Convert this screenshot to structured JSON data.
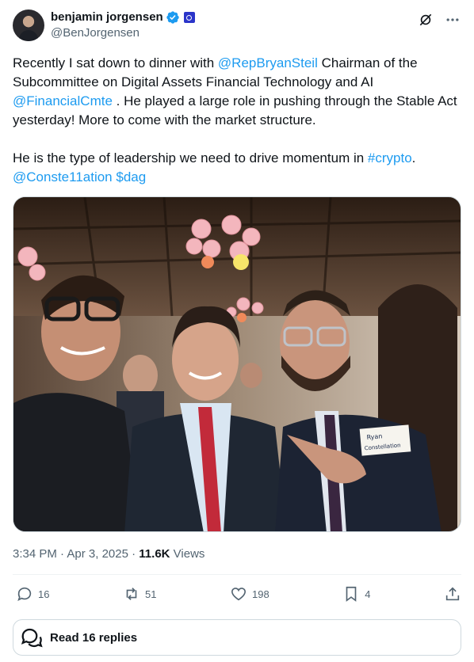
{
  "author": {
    "display_name": "benjamin jorgensen",
    "handle": "@BenJorgensen"
  },
  "tweet": {
    "p1": {
      "t1": "Recently I sat down to dinner with ",
      "m1": "@RepBryanSteil",
      "t2": " Chairman of the Subcommittee on Digital Assets Financial Technology and AI ",
      "m2": "@FinancialCmte",
      "t3": " . He played a large role in pushing through the Stable Act yesterday! More to come with the market structure."
    },
    "p2": {
      "t1": "He is the type of leadership we need to drive momentum in ",
      "hashtag": "#crypto",
      "t2": ".",
      "m3": "@Conste11ation",
      "cashtag": "$dag"
    }
  },
  "media": {
    "name_tag_line1": "Ryan",
    "name_tag_line2": "Constellation"
  },
  "meta": {
    "time": "3:34 PM",
    "sep1": " · ",
    "date": "Apr 3, 2025",
    "sep2": " · ",
    "views_count": "11.6K",
    "views_label": " Views"
  },
  "actions": {
    "replies": "16",
    "reposts": "51",
    "likes": "198",
    "bookmarks": "4"
  },
  "read_replies": "Read 16 replies",
  "colors": {
    "link": "#1d9bf0",
    "text": "#0f1419",
    "secondary": "#536471",
    "verified": "#1d9bf0",
    "org_badge": "#2b35c9"
  }
}
